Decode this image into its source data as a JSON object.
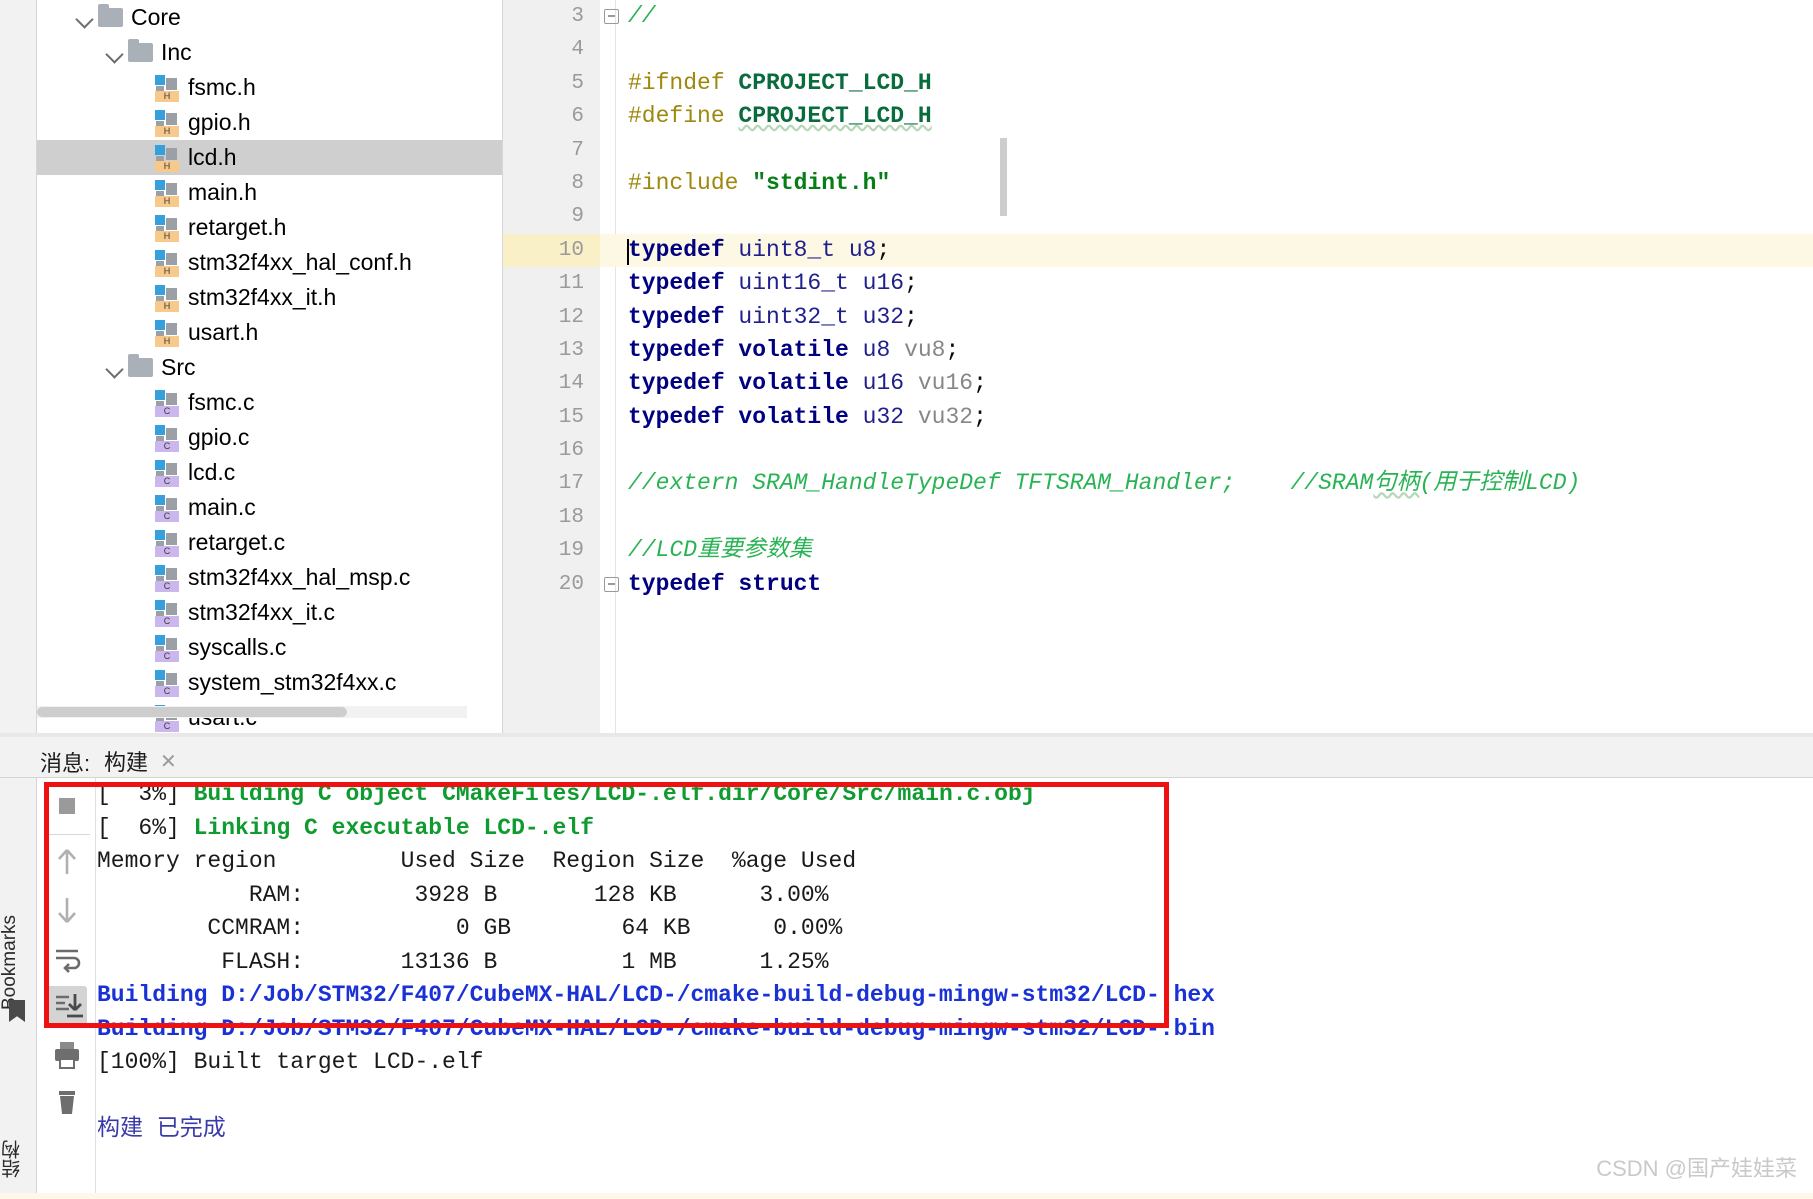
{
  "project_tree": {
    "rows": [
      {
        "label": "Core",
        "kind": "folder",
        "indent": 35,
        "expanded": true,
        "selected": false
      },
      {
        "label": "Inc",
        "kind": "folder",
        "indent": 65,
        "expanded": true,
        "selected": false
      },
      {
        "label": "fsmc.h",
        "kind": "h",
        "indent": 118,
        "expanded": false,
        "selected": false
      },
      {
        "label": "gpio.h",
        "kind": "h",
        "indent": 118,
        "expanded": false,
        "selected": false
      },
      {
        "label": "lcd.h",
        "kind": "h",
        "indent": 118,
        "expanded": false,
        "selected": true
      },
      {
        "label": "main.h",
        "kind": "h",
        "indent": 118,
        "expanded": false,
        "selected": false
      },
      {
        "label": "retarget.h",
        "kind": "h",
        "indent": 118,
        "expanded": false,
        "selected": false
      },
      {
        "label": "stm32f4xx_hal_conf.h",
        "kind": "h",
        "indent": 118,
        "expanded": false,
        "selected": false
      },
      {
        "label": "stm32f4xx_it.h",
        "kind": "h",
        "indent": 118,
        "expanded": false,
        "selected": false
      },
      {
        "label": "usart.h",
        "kind": "h",
        "indent": 118,
        "expanded": false,
        "selected": false
      },
      {
        "label": "Src",
        "kind": "folder",
        "indent": 65,
        "expanded": true,
        "selected": false
      },
      {
        "label": "fsmc.c",
        "kind": "c",
        "indent": 118,
        "expanded": false,
        "selected": false
      },
      {
        "label": "gpio.c",
        "kind": "c",
        "indent": 118,
        "expanded": false,
        "selected": false
      },
      {
        "label": "lcd.c",
        "kind": "c",
        "indent": 118,
        "expanded": false,
        "selected": false
      },
      {
        "label": "main.c",
        "kind": "c",
        "indent": 118,
        "expanded": false,
        "selected": false
      },
      {
        "label": "retarget.c",
        "kind": "c",
        "indent": 118,
        "expanded": false,
        "selected": false
      },
      {
        "label": "stm32f4xx_hal_msp.c",
        "kind": "c",
        "indent": 118,
        "expanded": false,
        "selected": false
      },
      {
        "label": "stm32f4xx_it.c",
        "kind": "c",
        "indent": 118,
        "expanded": false,
        "selected": false
      },
      {
        "label": "syscalls.c",
        "kind": "c",
        "indent": 118,
        "expanded": false,
        "selected": false
      },
      {
        "label": "system_stm32f4xx.c",
        "kind": "c",
        "indent": 118,
        "expanded": false,
        "selected": false
      },
      {
        "label": "usart.c",
        "kind": "c",
        "indent": 118,
        "expanded": false,
        "selected": false
      }
    ],
    "header_badge_h": "H",
    "header_badge_c": "C"
  },
  "editor": {
    "lines": [
      {
        "n": "3",
        "fold": "end",
        "current": false,
        "spans": [
          {
            "t": "//",
            "c": "cmt"
          }
        ]
      },
      {
        "n": "4",
        "fold": "none",
        "current": false,
        "spans": []
      },
      {
        "n": "5",
        "fold": "none",
        "current": false,
        "spans": [
          {
            "t": "#ifndef ",
            "c": "pp"
          },
          {
            "t": "CPROJECT_LCD_H",
            "c": "mac"
          }
        ]
      },
      {
        "n": "6",
        "fold": "none",
        "current": false,
        "spans": [
          {
            "t": "#define ",
            "c": "pp"
          },
          {
            "t": "CPROJECT_LCD_H",
            "c": "mac squiggle"
          }
        ]
      },
      {
        "n": "7",
        "fold": "none",
        "current": false,
        "spans": []
      },
      {
        "n": "8",
        "fold": "none",
        "current": false,
        "spans": [
          {
            "t": "#include ",
            "c": "pp"
          },
          {
            "t": "\"stdint.h\"",
            "c": "str"
          }
        ]
      },
      {
        "n": "9",
        "fold": "none",
        "current": false,
        "spans": []
      },
      {
        "n": "10",
        "fold": "none",
        "current": true,
        "spans": [
          {
            "t": "typedef ",
            "c": "kw"
          },
          {
            "t": "uint8_t ",
            "c": "ty"
          },
          {
            "t": "u8",
            "c": "ty"
          },
          {
            "t": ";",
            "c": "punct"
          }
        ]
      },
      {
        "n": "11",
        "fold": "none",
        "current": false,
        "spans": [
          {
            "t": "typedef ",
            "c": "kw"
          },
          {
            "t": "uint16_t ",
            "c": "ty"
          },
          {
            "t": "u16",
            "c": "ty"
          },
          {
            "t": ";",
            "c": "punct"
          }
        ]
      },
      {
        "n": "12",
        "fold": "none",
        "current": false,
        "spans": [
          {
            "t": "typedef ",
            "c": "kw"
          },
          {
            "t": "uint32_t ",
            "c": "ty"
          },
          {
            "t": "u32",
            "c": "ty"
          },
          {
            "t": ";",
            "c": "punct"
          }
        ]
      },
      {
        "n": "13",
        "fold": "none",
        "current": false,
        "spans": [
          {
            "t": "typedef ",
            "c": "kw"
          },
          {
            "t": "volatile ",
            "c": "kw"
          },
          {
            "t": "u8 ",
            "c": "ty"
          },
          {
            "t": "vu8",
            "c": "vv"
          },
          {
            "t": ";",
            "c": "punct"
          }
        ]
      },
      {
        "n": "14",
        "fold": "none",
        "current": false,
        "spans": [
          {
            "t": "typedef ",
            "c": "kw"
          },
          {
            "t": "volatile ",
            "c": "kw"
          },
          {
            "t": "u16 ",
            "c": "ty"
          },
          {
            "t": "vu16",
            "c": "vv"
          },
          {
            "t": ";",
            "c": "punct"
          }
        ]
      },
      {
        "n": "15",
        "fold": "none",
        "current": false,
        "spans": [
          {
            "t": "typedef ",
            "c": "kw"
          },
          {
            "t": "volatile ",
            "c": "kw"
          },
          {
            "t": "u32 ",
            "c": "ty"
          },
          {
            "t": "vu32",
            "c": "vv"
          },
          {
            "t": ";",
            "c": "punct"
          }
        ]
      },
      {
        "n": "16",
        "fold": "none",
        "current": false,
        "spans": []
      },
      {
        "n": "17",
        "fold": "none",
        "current": false,
        "spans": [
          {
            "t": "//extern SRAM_HandleTypeDef TFTSRAM_Handler;    //SRAM",
            "c": "cmt"
          },
          {
            "t": "句柄",
            "c": "cmt squiggle"
          },
          {
            "t": "(用于控制LCD)",
            "c": "cmt"
          }
        ]
      },
      {
        "n": "18",
        "fold": "none",
        "current": false,
        "spans": []
      },
      {
        "n": "19",
        "fold": "none",
        "current": false,
        "spans": [
          {
            "t": "//LCD重要参数集",
            "c": "cmt"
          }
        ]
      },
      {
        "n": "20",
        "fold": "start",
        "current": false,
        "spans": [
          {
            "t": "typedef ",
            "c": "kw"
          },
          {
            "t": "struct",
            "c": "kw"
          }
        ]
      }
    ]
  },
  "panel": {
    "message_label": "消息:",
    "tab_label": "构建",
    "tab_close": "✕",
    "left_strip": {
      "bookmarks_label": "Bookmarks",
      "structure_label": "结构"
    },
    "toolbar_icons": [
      "stop-icon",
      "scroll-up-icon",
      "scroll-down-icon",
      "soft-wrap-icon",
      "scroll-to-end-icon",
      "print-icon",
      "delete-icon"
    ],
    "output_lines": [
      {
        "segments": [
          {
            "t": "[  3%] ",
            "c": "o-plain"
          },
          {
            "t": "Building C object CMakeFiles/LCD-.elf.dir/Core/Src/main.c.obj",
            "c": "o-green"
          }
        ]
      },
      {
        "segments": [
          {
            "t": "[  6%] ",
            "c": "o-plain"
          },
          {
            "t": "Linking C executable LCD-.elf",
            "c": "o-green"
          }
        ]
      },
      {
        "segments": [
          {
            "t": "Memory region         Used Size  Region Size  %age Used",
            "c": "o-plain"
          }
        ]
      },
      {
        "segments": [
          {
            "t": "           RAM:        3928 B       128 KB      3.00%",
            "c": "o-plain"
          }
        ]
      },
      {
        "segments": [
          {
            "t": "        CCMRAM:           0 GB        64 KB      0.00%",
            "c": "o-plain"
          }
        ]
      },
      {
        "segments": [
          {
            "t": "         FLASH:       13136 B         1 MB      1.25%",
            "c": "o-plain"
          }
        ]
      },
      {
        "segments": [
          {
            "t": "Building D:/Job/STM32/F407/CubeMX-HAL/LCD-/cmake-build-debug-mingw-stm32/LCD-.hex",
            "c": "o-blue"
          }
        ]
      },
      {
        "segments": [
          {
            "t": "Building D:/Job/STM32/F407/CubeMX-HAL/LCD-/cmake-build-debug-mingw-stm32/LCD-.bin",
            "c": "o-blue"
          }
        ]
      },
      {
        "segments": [
          {
            "t": "[100%] Built target LCD-.elf",
            "c": "o-plain"
          }
        ]
      },
      {
        "segments": [
          {
            "t": "",
            "c": "o-plain"
          }
        ]
      },
      {
        "segments": [
          {
            "t": "构建 已完成",
            "c": "o-cn"
          }
        ]
      }
    ]
  },
  "annotation": {
    "highlight_color": "#ee1111",
    "name": "build-output-highlight-rectangle"
  },
  "watermark": {
    "text": "CSDN @国产娃娃菜"
  }
}
